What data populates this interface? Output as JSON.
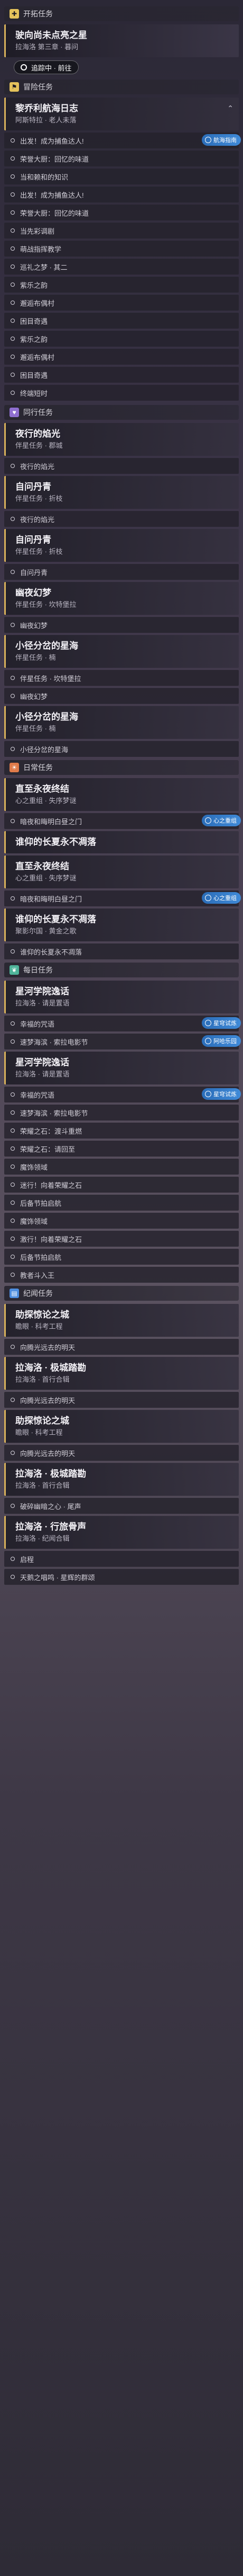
{
  "sections": [
    {
      "id": "trailblaze",
      "title": "开拓任务",
      "icon": "plus-icon",
      "color": "#e4c25b"
    },
    {
      "id": "adventure",
      "title": "冒险任务",
      "icon": "flag-icon",
      "color": "#e4c25b"
    },
    {
      "id": "companion",
      "title": "同行任务",
      "icon": "heart-icon",
      "color": "#8f6fd0"
    },
    {
      "id": "daily",
      "title": "日常任务",
      "icon": "sun-icon",
      "color": "#e07b4a"
    },
    {
      "id": "events",
      "title": "每日任务",
      "icon": "leaf-icon",
      "color": "#4fb49a"
    },
    {
      "id": "story",
      "title": "纪闻任务",
      "icon": "book-icon",
      "color": "#4d8ee0"
    }
  ],
  "trailblaze": {
    "quest_title": "驶向尚未点亮之星",
    "quest_sub": "拉海洛 第三章 · 暮问",
    "trace_label": "追踪中 · 前往"
  },
  "adventure": {
    "quest_title": "黎乔利航海日志",
    "quest_sub": "阿斯特拉 · 老人未落",
    "badge_label": "航海指南",
    "objectives": [
      "出发！成为捕鱼达人!",
      "荣誉大厨：回忆的味道",
      "当和赖和的知识",
      "出发！成为捕鱼达人!",
      "荣誉大厨：回忆的味道",
      "当先彩调剧",
      "萌战指挥教学",
      "巡礼之梦 · 其二",
      "紫乐之韵",
      "邂逅布偶村",
      "困目奇遇",
      "紫乐之韵",
      "邂逅布偶村",
      "困目奇遇",
      "终端短时"
    ]
  },
  "companion": {
    "quests": [
      {
        "title": "夜行的焰光",
        "sub": "伴星任务 · 郡城",
        "objectives": [
          "夜行的焰光"
        ]
      },
      {
        "title": "自问丹青",
        "sub": "伴星任务 · 折枝",
        "objectives": [
          "夜行的焰光"
        ]
      },
      {
        "title": "自问丹青",
        "sub": "伴星任务 · 折枝",
        "objectives": [
          "自问丹青"
        ]
      },
      {
        "title": "幽夜幻梦",
        "sub": "伴星任务 · 坎特堡拉",
        "objectives": [
          "幽夜幻梦"
        ]
      },
      {
        "title": "小径分岔的星海",
        "sub": "伴星任务 · 楠",
        "objectives": [
          "伴星任务 · 坎特堡拉",
          "幽夜幻梦"
        ]
      },
      {
        "title": "小径分岔的星海",
        "sub": "伴星任务 · 楠",
        "objectives": [
          "小径分岔的星海"
        ]
      }
    ]
  },
  "daily": {
    "badge_label": "心之重组",
    "quests": [
      {
        "title": "直至永夜终结",
        "sub": "心之重组 · 失序梦谜",
        "objectives": [
          "暗夜和晦明白昼之门"
        ],
        "badge": true
      },
      {
        "title": "谁仰的长夏永不凋落",
        "sub": "",
        "objectives": []
      },
      {
        "title": "直至永夜终结",
        "sub": "心之重组 · 失序梦谜",
        "objectives": [
          "暗夜和晦明白昼之门"
        ],
        "badge": true
      },
      {
        "title": "谁仰的长夏永不凋落",
        "sub": "聚影尔国 · 黄金之歌",
        "objectives": [
          "谁仰的长夏永不凋落"
        ]
      }
    ]
  },
  "events": {
    "badge_label": "星穹试炼",
    "badge_label_2": "阿哈乐园",
    "quests": [
      {
        "title": "星河学院逸话",
        "sub": "拉海洛 · 请是置语",
        "objectives": [
          "幸福的咒语",
          "速梦海滨 · 索拉电影节"
        ]
      },
      {
        "title": "星河学院逸话",
        "sub": "拉海洛 · 请是置语",
        "objectives": [
          "幸福的咒语",
          "速梦海滨 · 索拉电影节",
          "荣耀之石：渡斗重燃",
          "荣耀之石：请回至",
          "魔饰领域",
          "迷行！向着荣耀之石",
          "后备节拍启航",
          "魔饰领域",
          "激行！向着荣耀之石",
          "后备节拍启航",
          "教者斗入王"
        ]
      }
    ]
  },
  "story": {
    "quests": [
      {
        "title": "助探惊论之城",
        "sub": "瞻眼 · 科考工程",
        "objectives": [
          "向腾光远去的明天"
        ]
      },
      {
        "title": "拉海洛 · 极城踏勘",
        "sub": "拉海洛 · 首行合辑",
        "objectives": [
          "向腾光远去的明天"
        ]
      },
      {
        "title": "助探惊论之城",
        "sub": "瞻眼 · 科考工程",
        "objectives": [
          "向腾光远去的明天"
        ]
      },
      {
        "title": "拉海洛 · 极城踏勘",
        "sub": "拉海洛 · 首行合辑",
        "objectives": [
          "破碎幽暗之心 · 尾声"
        ]
      }
    ]
  },
  "final": {
    "title": "拉海洛 · 行旅骨声",
    "sub": "拉海洛 · 纪闻合辑",
    "objectives": [
      "启程",
      "天鹅之唱鸣 · 星辉的群颂"
    ]
  }
}
